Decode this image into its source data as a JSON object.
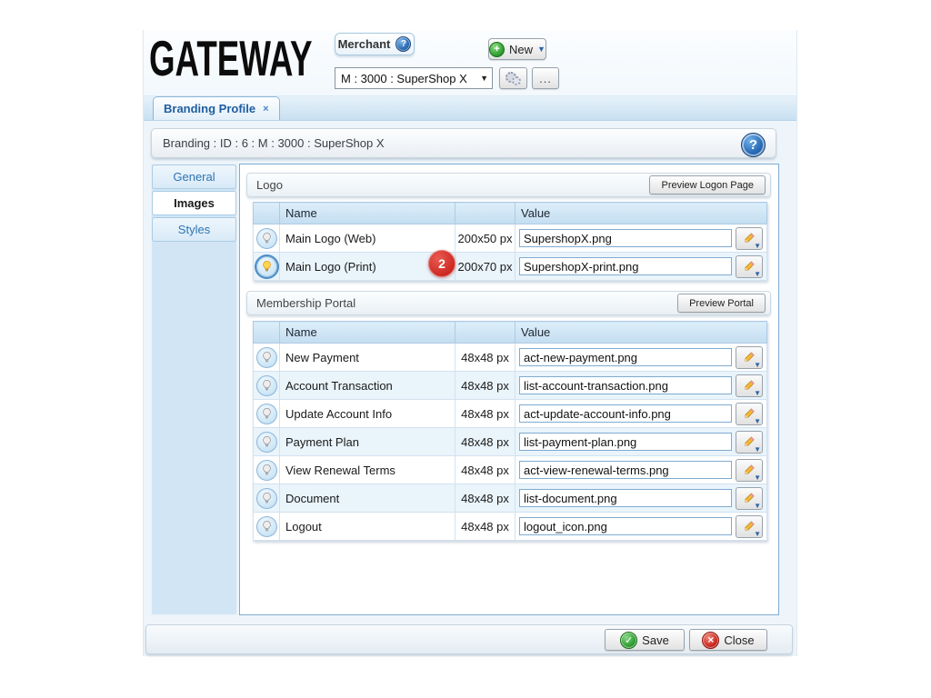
{
  "colors": {
    "accent_blue": "#1e5d9f",
    "badge_red": "#cc2a22",
    "save_green": "#2f9e2f",
    "close_red": "#cc2a21"
  },
  "header": {
    "logo_text": "GATEWAY",
    "merchant_label": "Merchant",
    "help_glyph": "?",
    "new_button_label": "New",
    "merchant_select_value": "M : 3000 : SuperShop X",
    "more_button_label": "..."
  },
  "tab_bar": {
    "active_tab": "Branding Profile",
    "close_glyph": "×"
  },
  "breadcrumb": {
    "text": "Branding : ID : 6 : M : 3000 : SuperShop X"
  },
  "sidebar": {
    "items": [
      {
        "label": "General"
      },
      {
        "label": "Images"
      },
      {
        "label": "Styles"
      }
    ]
  },
  "logo_section": {
    "title": "Logo",
    "preview_button": "Preview Logon Page",
    "columns": {
      "name": "Name",
      "value": "Value"
    },
    "rows": [
      {
        "name": "Main Logo (Web)",
        "size": "200x50 px",
        "value": "SupershopX.png"
      },
      {
        "name": "Main Logo (Print)",
        "size": "200x70 px",
        "value": "SupershopX-print.png"
      }
    ]
  },
  "portal_section": {
    "title": "Membership Portal",
    "preview_button": "Preview Portal",
    "columns": {
      "name": "Name",
      "value": "Value"
    },
    "rows": [
      {
        "name": "New Payment",
        "size": "48x48 px",
        "value": "act-new-payment.png"
      },
      {
        "name": "Account Transaction",
        "size": "48x48 px",
        "value": "list-account-transaction.png"
      },
      {
        "name": "Update Account Info",
        "size": "48x48 px",
        "value": "act-update-account-info.png"
      },
      {
        "name": "Payment Plan",
        "size": "48x48 px",
        "value": "list-payment-plan.png"
      },
      {
        "name": "View Renewal Terms",
        "size": "48x48 px",
        "value": "act-view-renewal-terms.png"
      },
      {
        "name": "Document",
        "size": "48x48 px",
        "value": "list-document.png"
      },
      {
        "name": "Logout",
        "size": "48x48 px",
        "value": "logout_icon.png"
      }
    ]
  },
  "annotation": {
    "badge_label": "2"
  },
  "footer": {
    "save_label": "Save",
    "close_label": "Close"
  }
}
